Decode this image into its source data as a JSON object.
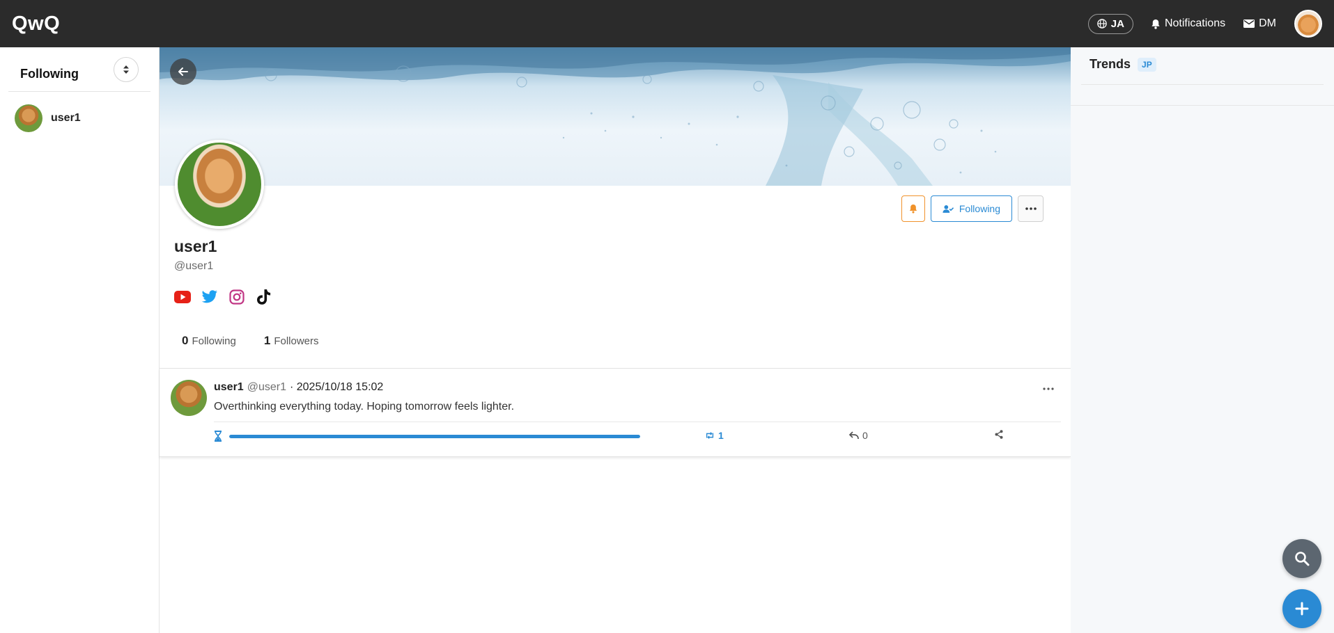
{
  "app": {
    "logo": "QwQ"
  },
  "topbar": {
    "lang": "JA",
    "notifications": "Notifications",
    "dm": "DM"
  },
  "sidebar": {
    "title": "Following",
    "items": [
      {
        "label": "user1"
      }
    ]
  },
  "profile": {
    "name": "user1",
    "handle": "@user1",
    "following_button": "Following",
    "following_count": "0",
    "following_label": "Following",
    "followers_count": "1",
    "followers_label": "Followers",
    "social_icons": [
      "youtube-icon",
      "twitter-icon",
      "instagram-icon",
      "tiktok-icon"
    ]
  },
  "post": {
    "author": "user1",
    "handle": "@user1",
    "timestamp": "· 2025/10/18 15:02",
    "text": "Overthinking everything today. Hoping tomorrow feels lighter.",
    "progress": 1.0,
    "reposts": "1",
    "replies": "0"
  },
  "trends": {
    "title": "Trends",
    "badge": "JP"
  },
  "colors": {
    "accent": "#2a8ad4",
    "topbar": "#2b2b2b",
    "bell": "#f0922b",
    "youtube": "#e62117",
    "twitter": "#1da1f2",
    "instagram": "#c13584"
  }
}
